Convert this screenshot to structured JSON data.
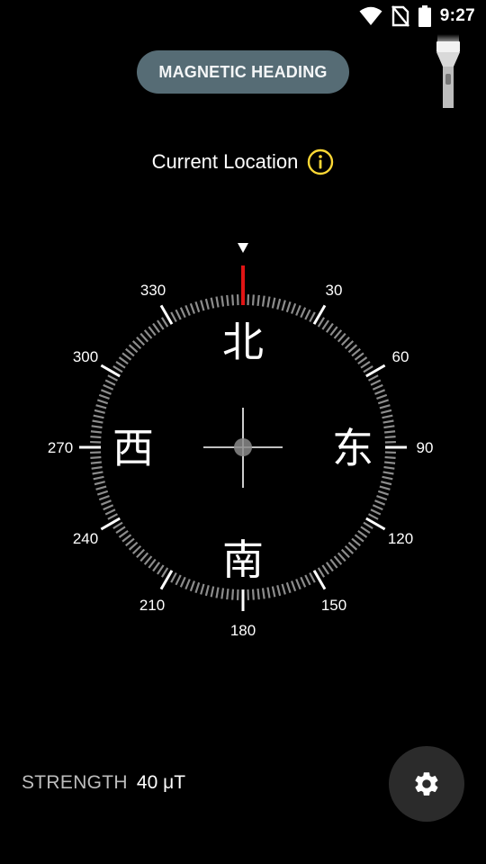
{
  "status_bar": {
    "time": "9:27",
    "icons": [
      "wifi-icon",
      "no-sim-icon",
      "battery-icon"
    ]
  },
  "heading_mode_button": {
    "label": "MAGNETIC HEADING"
  },
  "flashlight": {
    "icon": "flashlight-icon"
  },
  "location": {
    "label": "Current Location",
    "icon": "info-icon",
    "icon_color": "#fdd835"
  },
  "compass": {
    "cardinals": {
      "north": "北",
      "east": "东",
      "south": "南",
      "west": "西"
    },
    "degree_labels": [
      "330",
      "30",
      "300",
      "60",
      "270",
      "90",
      "240",
      "120",
      "210",
      "150",
      "180"
    ],
    "pointer_color": "#e01515",
    "indicator": "triangle-marker"
  },
  "strength": {
    "label": "STRENGTH",
    "value": "40 μT"
  },
  "settings_button": {
    "icon": "gear-icon"
  }
}
